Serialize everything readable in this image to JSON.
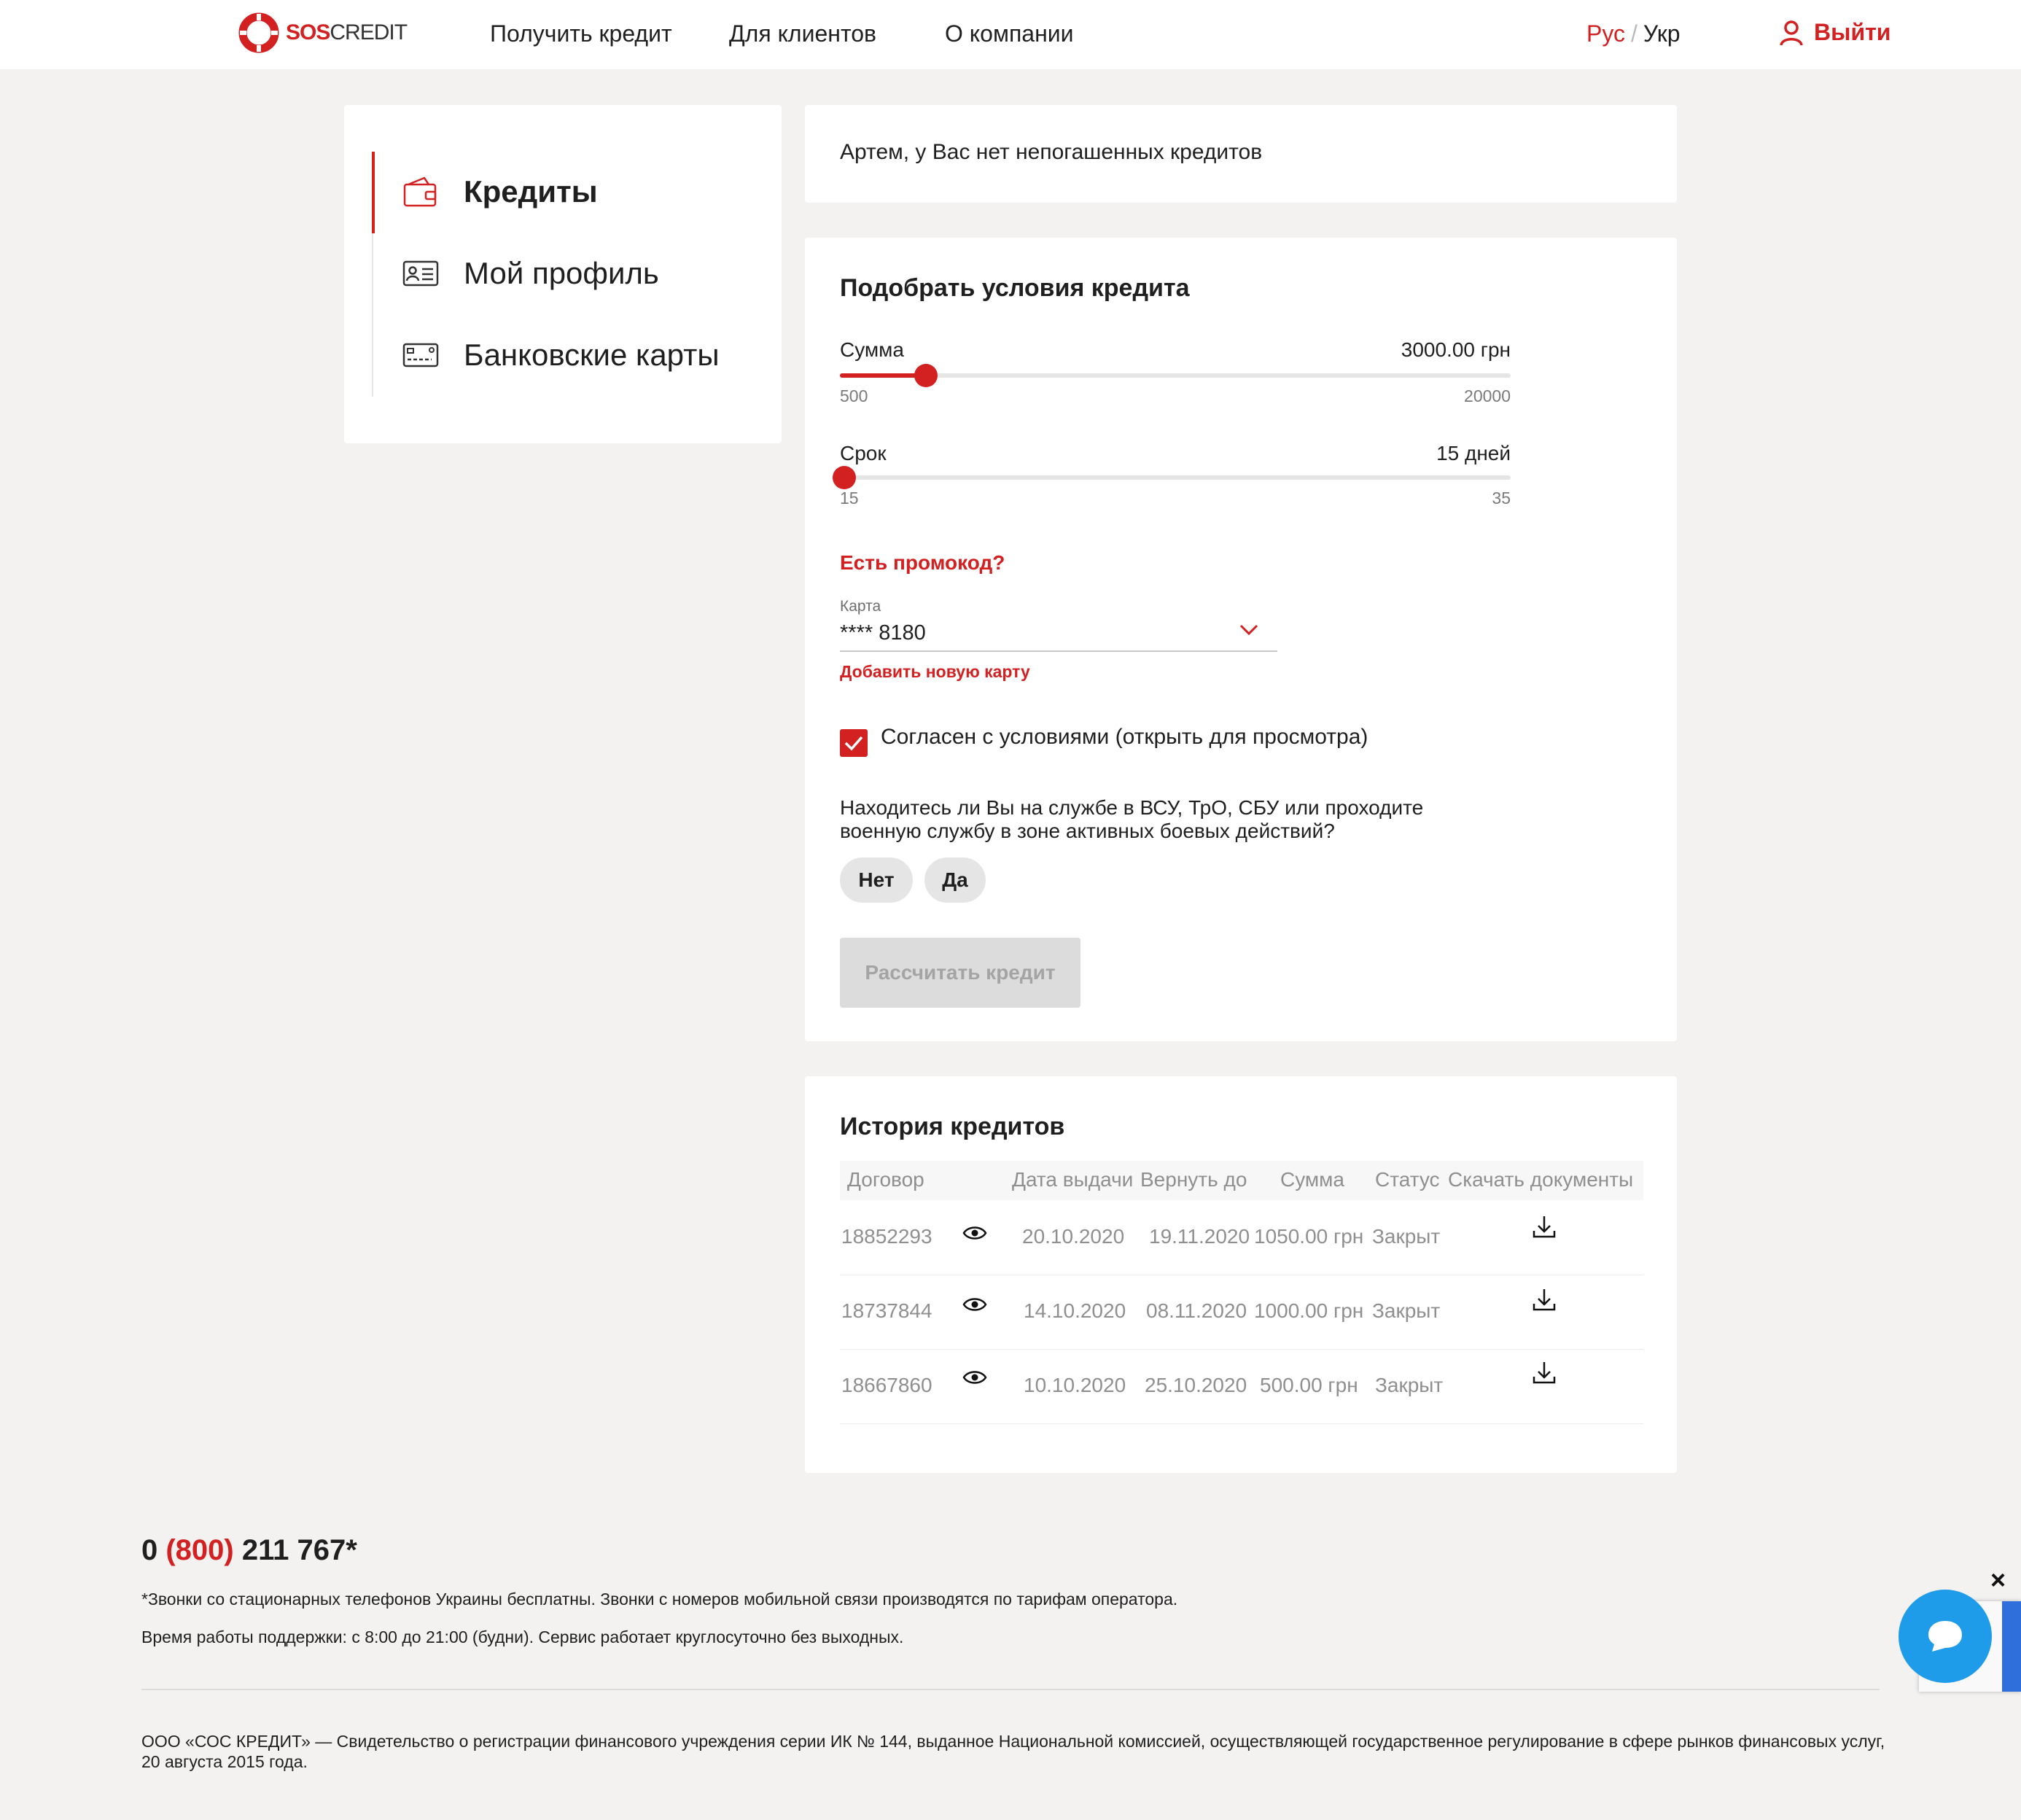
{
  "header": {
    "logo": {
      "sos": "SOS",
      "credit": "CREDIT"
    },
    "nav": [
      "Получить кредит",
      "Для клиентов",
      "О компании"
    ],
    "lang": {
      "active": "Рус",
      "separator": "/",
      "other": "Укр"
    },
    "logout_label": "Выйти"
  },
  "sidebar": {
    "items": [
      {
        "label": "Кредиты",
        "icon": "wallet-icon",
        "active": true
      },
      {
        "label": "Мой профиль",
        "icon": "id-card-icon",
        "active": false
      },
      {
        "label": "Банковские карты",
        "icon": "bank-card-icon",
        "active": false
      }
    ]
  },
  "notice": {
    "text": "Артем, у Вас нет непогашенных кредитов"
  },
  "calculator": {
    "title": "Подобрать условия кредита",
    "amount": {
      "label": "Сумма",
      "value_text": "3000.00 грн",
      "value": 3000,
      "min": 500,
      "max": 20000,
      "min_label": "500",
      "max_label": "20000"
    },
    "term": {
      "label": "Срок",
      "value_text": "15 дней",
      "value": 15,
      "min": 15,
      "max": 35,
      "min_label": "15",
      "max_label": "35"
    },
    "promo_link": "Есть промокод?",
    "card_select": {
      "caption": "Карта",
      "value": "**** 8180"
    },
    "add_card_link": "Добавить новую карту",
    "agree": {
      "checked": true,
      "label": "Согласен с условиями (открыть для просмотра)"
    },
    "military_question": "Находитесь ли Вы на службе в ВСУ, ТрО, СБУ или проходите военную службу в зоне активных боевых действий?",
    "answers": [
      "Нет",
      "Да"
    ],
    "submit_label": "Рассчитать кредит"
  },
  "history": {
    "title": "История кредитов",
    "columns": [
      "Договор",
      "Дата выдачи",
      "Вернуть до",
      "Сумма",
      "Статус",
      "Скачать документы"
    ],
    "rows": [
      {
        "contract": "18852293",
        "issued": "20.10.2020",
        "due": "19.11.2020",
        "amount": "1050.00 грн",
        "status": "Закрыт"
      },
      {
        "contract": "18737844",
        "issued": "14.10.2020",
        "due": "08.11.2020",
        "amount": "1000.00 грн",
        "status": "Закрыт"
      },
      {
        "contract": "18667860",
        "issued": "10.10.2020",
        "due": "25.10.2020",
        "amount": "500.00 грн",
        "status": "Закрыт"
      }
    ]
  },
  "footer": {
    "phone": {
      "prefix": "0 ",
      "code": "(800)",
      "number": " 211 767*"
    },
    "note": "*Звонки со стационарных телефонов Украины бесплатны. Звонки с номеров мобильной связи производятся по тарифам оператора.",
    "hours": "Время работы поддержки: с 8:00 до 21:00 (будни). Сервис работает круглосуточно без выходных.",
    "legal": "ООО «СОС КРЕДИТ» — Свидетельство о регистрации финансового учреждения серии ИК № 144, выданное Национальной комиссией, осуществляющей государственное регулирование в сфере рынков финансовых услуг, 20 августа 2015 года."
  },
  "widgets": {
    "chat_close": "×"
  },
  "colors": {
    "accent": "#d32021",
    "background": "#f3f2f1",
    "chat": "#1e9be9"
  }
}
